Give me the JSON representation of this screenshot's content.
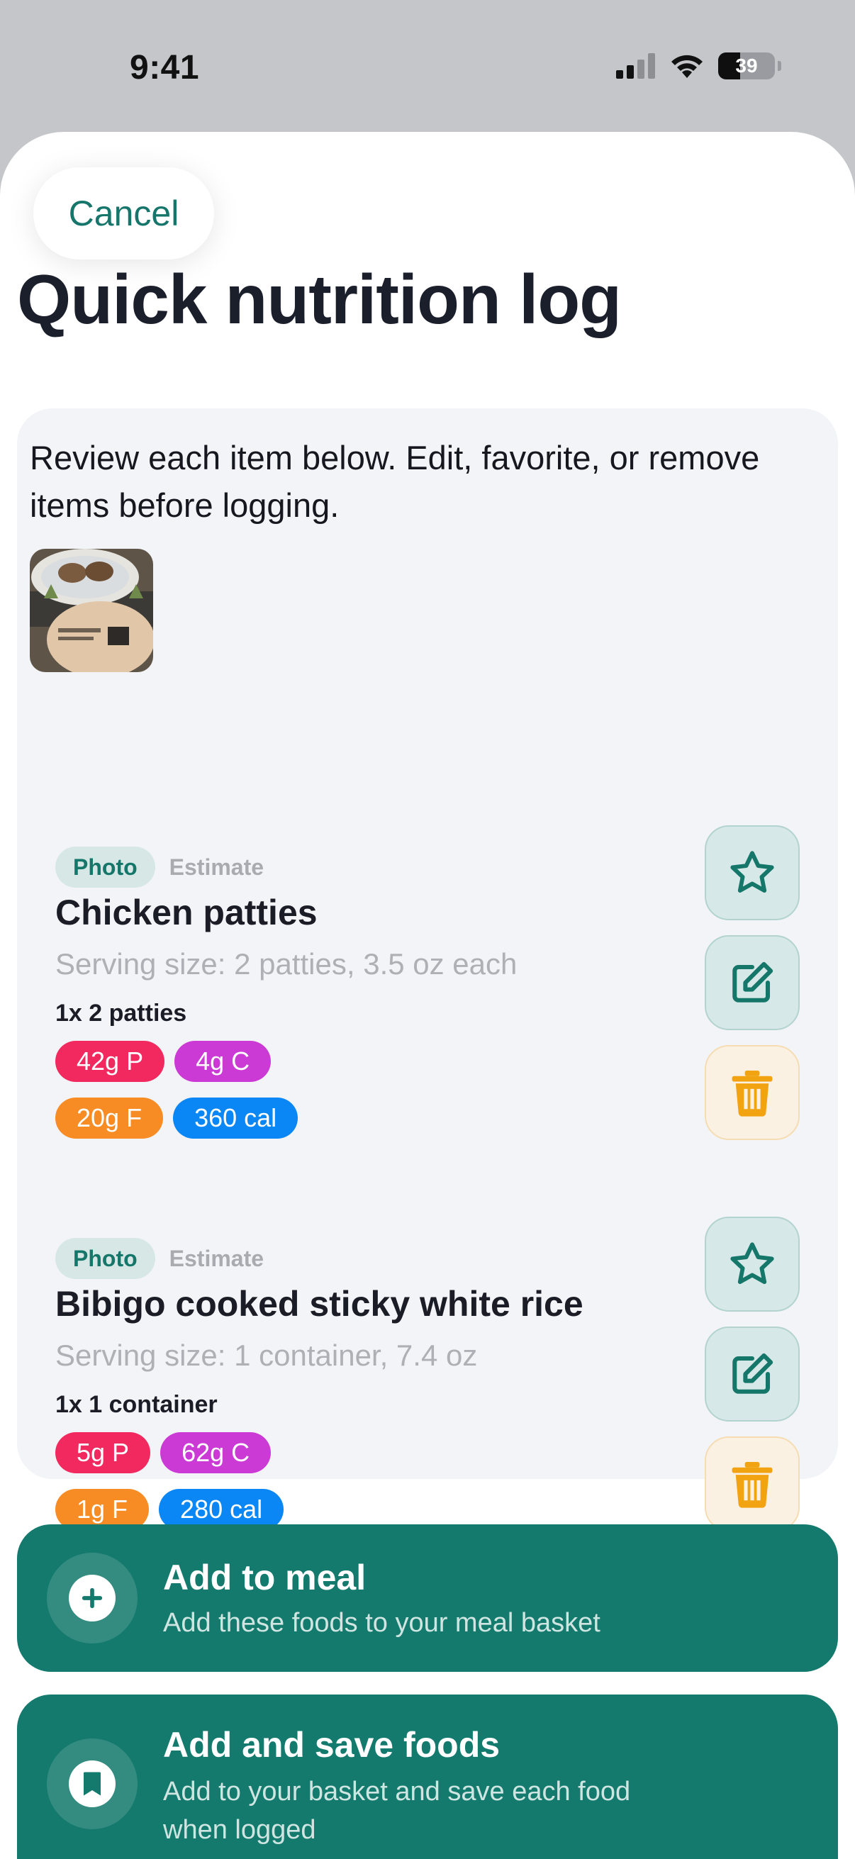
{
  "status_bar": {
    "time": "9:41",
    "battery": "39",
    "battery_level": 0.39
  },
  "header": {
    "cancel_label": "Cancel",
    "title": "Quick nutrition log"
  },
  "review": {
    "intro": "Review each item below. Edit, favorite, or remove items before logging."
  },
  "foods": [
    {
      "source_tag": "Photo",
      "estimate_tag": "Estimate",
      "name": "Chicken patties",
      "serving": "Serving size: 2 patties, 3.5 oz each",
      "quantity": "1x 2 patties",
      "protein": "42g P",
      "carbs": "4g C",
      "fat": "20g F",
      "calories": "360 cal"
    },
    {
      "source_tag": "Photo",
      "estimate_tag": "Estimate",
      "name": "Bibigo cooked sticky white rice",
      "serving": "Serving size: 1 container, 7.4 oz",
      "quantity": "1x 1 container",
      "protein": "5g P",
      "carbs": "62g C",
      "fat": "1g F",
      "calories": "280 cal"
    }
  ],
  "actions": {
    "add_to_meal": {
      "title": "Add to meal",
      "subtitle": "Add these foods to your meal basket"
    },
    "add_and_save": {
      "title": "Add and save foods",
      "subtitle": "Add to your basket and save each food when logged"
    }
  },
  "colors": {
    "accent": "#137a6d",
    "protein": "#f2295f",
    "carbs": "#cc3ad6",
    "fat": "#f78c25",
    "calories": "#0a86f5",
    "delete": "#f2a312"
  },
  "icons": [
    "signal-icon",
    "wifi-icon",
    "battery-icon",
    "star-icon",
    "edit-icon",
    "trash-icon",
    "plus-icon",
    "bookmark-icon"
  ]
}
